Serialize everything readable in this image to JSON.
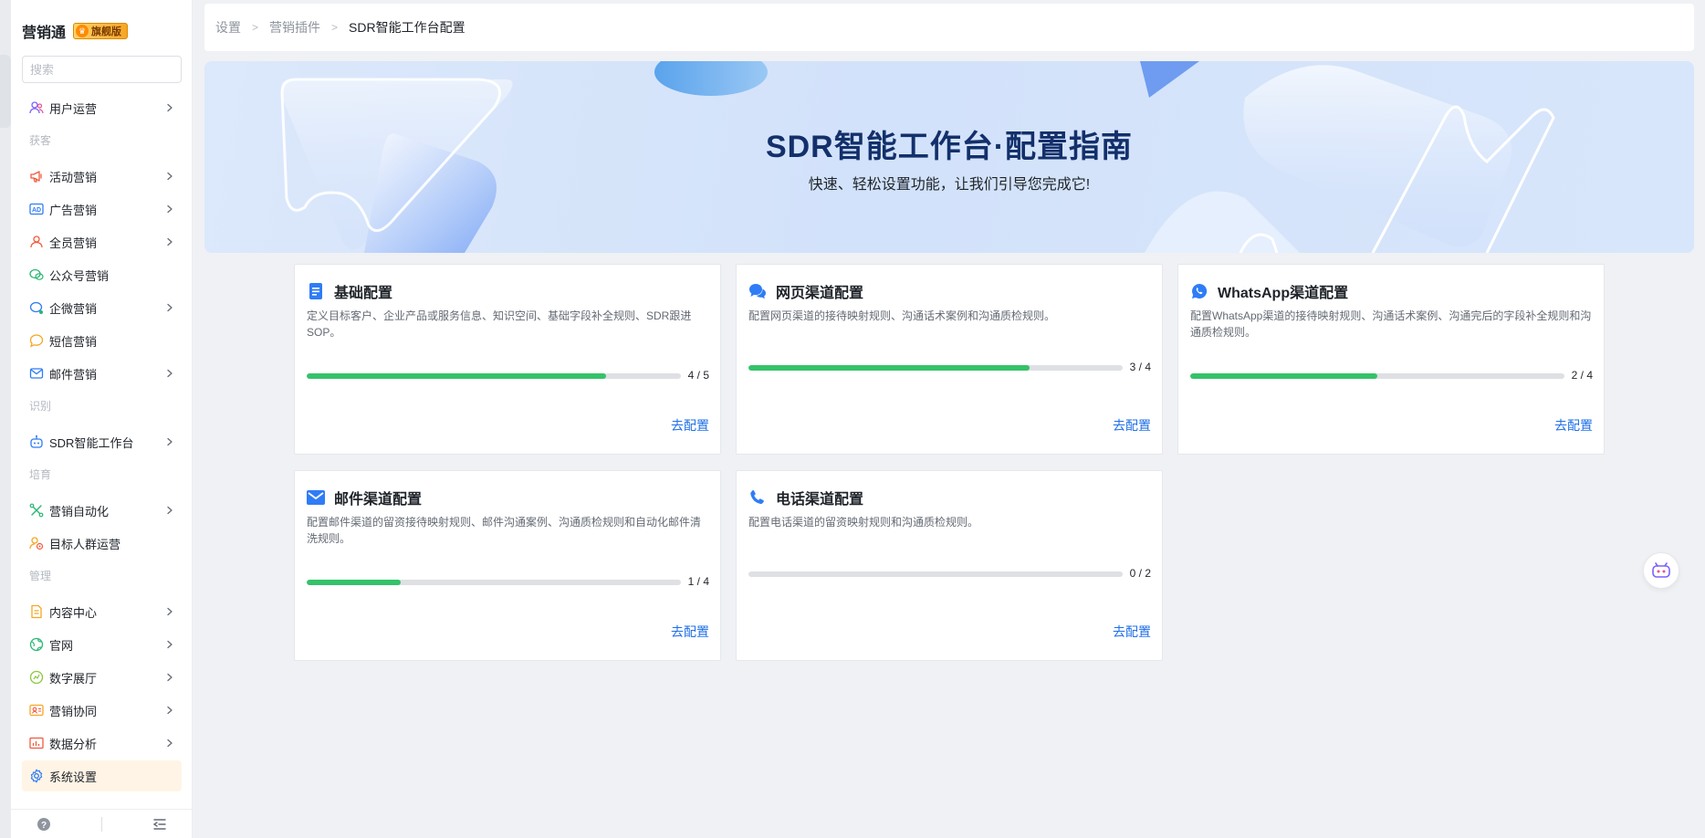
{
  "brand": {
    "name": "营销通",
    "badge": "旗舰版"
  },
  "search": {
    "placeholder": "搜索"
  },
  "sidebar": {
    "items": [
      {
        "label": "用户运营",
        "icon": "users-icon"
      },
      {
        "group": "获客"
      },
      {
        "label": "活动营销",
        "icon": "megaphone-icon"
      },
      {
        "label": "广告营销",
        "icon": "ad-icon"
      },
      {
        "label": "全员营销",
        "icon": "team-icon"
      },
      {
        "label": "公众号营销",
        "icon": "wechat-icon"
      },
      {
        "label": "企微营销",
        "icon": "wecom-icon"
      },
      {
        "label": "短信营销",
        "icon": "sms-icon"
      },
      {
        "label": "邮件营销",
        "icon": "mail-icon"
      },
      {
        "group": "识别"
      },
      {
        "label": "SDR智能工作台",
        "icon": "robot-icon"
      },
      {
        "group": "培育"
      },
      {
        "label": "营销自动化",
        "icon": "automation-icon"
      },
      {
        "label": "目标人群运营",
        "icon": "target-users-icon"
      },
      {
        "group": "管理"
      },
      {
        "label": "内容中心",
        "icon": "document-icon"
      },
      {
        "label": "官网",
        "icon": "globe-icon"
      },
      {
        "label": "数字展厅",
        "icon": "showroom-icon"
      },
      {
        "label": "营销协同",
        "icon": "collab-icon"
      },
      {
        "label": "数据分析",
        "icon": "chart-icon"
      },
      {
        "label": "系统设置",
        "icon": "gear-icon",
        "active": true
      }
    ]
  },
  "breadcrumb": [
    "设置",
    "营销插件",
    "SDR智能工作台配置"
  ],
  "banner": {
    "title": "SDR智能工作台·配置指南",
    "subtitle": "快速、轻松设置功能，让我们引导您完成它!"
  },
  "cards": [
    {
      "title": "基础配置",
      "icon": "doc-icon",
      "desc": "定义目标客户、企业产品或服务信息、知识空间、基础字段补全规则、SDR跟进SOP。",
      "done": 4,
      "total": 5,
      "progress_text": "4 / 5",
      "link": "去配置"
    },
    {
      "title": "网页渠道配置",
      "icon": "chat-bubbles-icon",
      "desc": "配置网页渠道的接待映射规则、沟通话术案例和沟通质检规则。",
      "done": 3,
      "total": 4,
      "progress_text": "3 / 4",
      "link": "去配置"
    },
    {
      "title": "WhatsApp渠道配置",
      "icon": "whatsapp-icon",
      "desc": "配置WhatsApp渠道的接待映射规则、沟通话术案例、沟通完后的字段补全规则和沟通质检规则。",
      "done": 2,
      "total": 4,
      "progress_text": "2 / 4",
      "link": "去配置"
    },
    {
      "title": "邮件渠道配置",
      "icon": "envelope-icon",
      "desc": "配置邮件渠道的留资接待映射规则、邮件沟通案例、沟通质检规则和自动化邮件清洗规则。",
      "done": 1,
      "total": 4,
      "progress_text": "1 / 4",
      "link": "去配置"
    },
    {
      "title": "电话渠道配置",
      "icon": "phone-icon",
      "desc": "配置电话渠道的留资映射规则和沟通质检规则。",
      "done": 0,
      "total": 2,
      "progress_text": "0 / 2",
      "link": "去配置"
    }
  ],
  "colors": {
    "accent": "#1f6fe8",
    "progress": "#34c26a",
    "active_bg": "#fff4e5",
    "banner_title": "#13306b"
  }
}
